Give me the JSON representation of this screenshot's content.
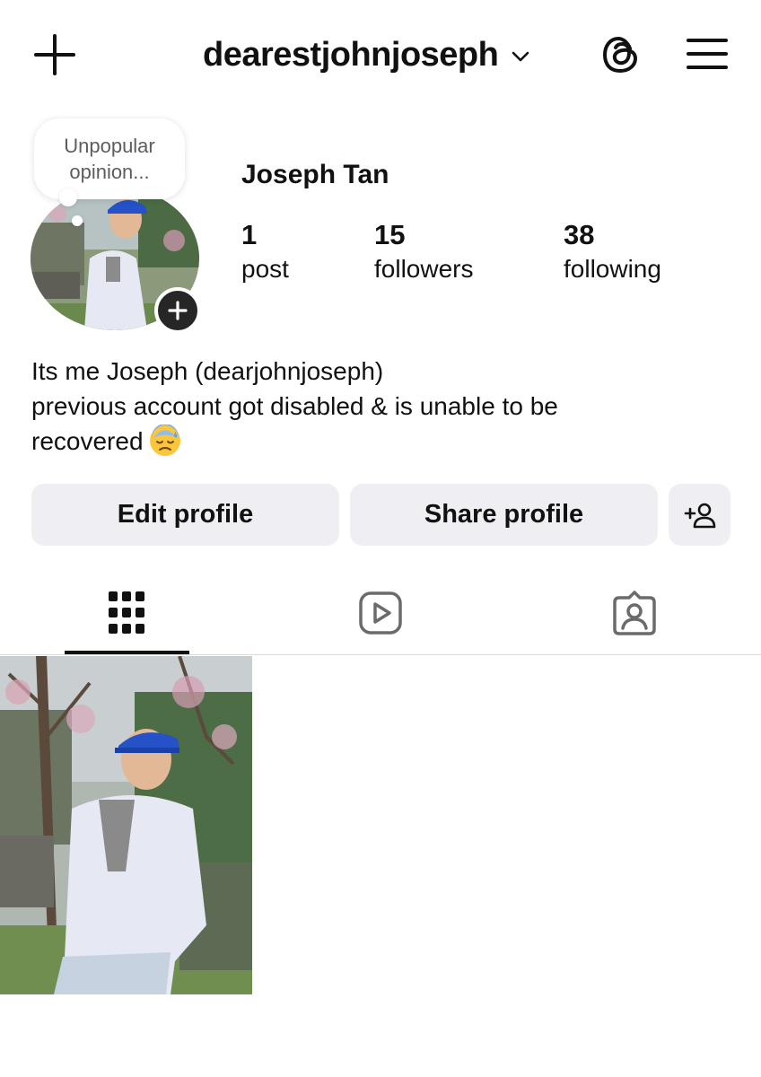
{
  "header": {
    "username": "dearestjohnjoseph",
    "icons": [
      "plus-icon",
      "chevron-down-icon",
      "threads-icon",
      "hamburger-menu-icon"
    ]
  },
  "note": {
    "text": "Unpopular opinion..."
  },
  "profile": {
    "full_name": "Joseph Tan",
    "stats": {
      "posts": {
        "value": "1",
        "label": "post"
      },
      "followers": {
        "value": "15",
        "label": "followers"
      },
      "following": {
        "value": "38",
        "label": "following"
      }
    },
    "bio": {
      "line1": "Its me Joseph (dearjohnjoseph)",
      "line2": "previous account got disabled & is unable to be",
      "line3": "recovered"
    }
  },
  "buttons": {
    "edit_profile": "Edit profile",
    "share_profile": "Share profile"
  },
  "tabs": [
    {
      "name": "posts",
      "icon": "grid-icon",
      "active": true
    },
    {
      "name": "reels",
      "icon": "reels-icon",
      "active": false
    },
    {
      "name": "tagged",
      "icon": "tagged-icon",
      "active": false
    }
  ],
  "posts": [
    {
      "icon": "photo-thumbnail"
    }
  ],
  "colors": {
    "button_bg": "#efeff3",
    "text": "#111111",
    "note_text": "#5d5d5d",
    "divider": "#dbdbdb",
    "cap_blue": "#2552c7"
  }
}
